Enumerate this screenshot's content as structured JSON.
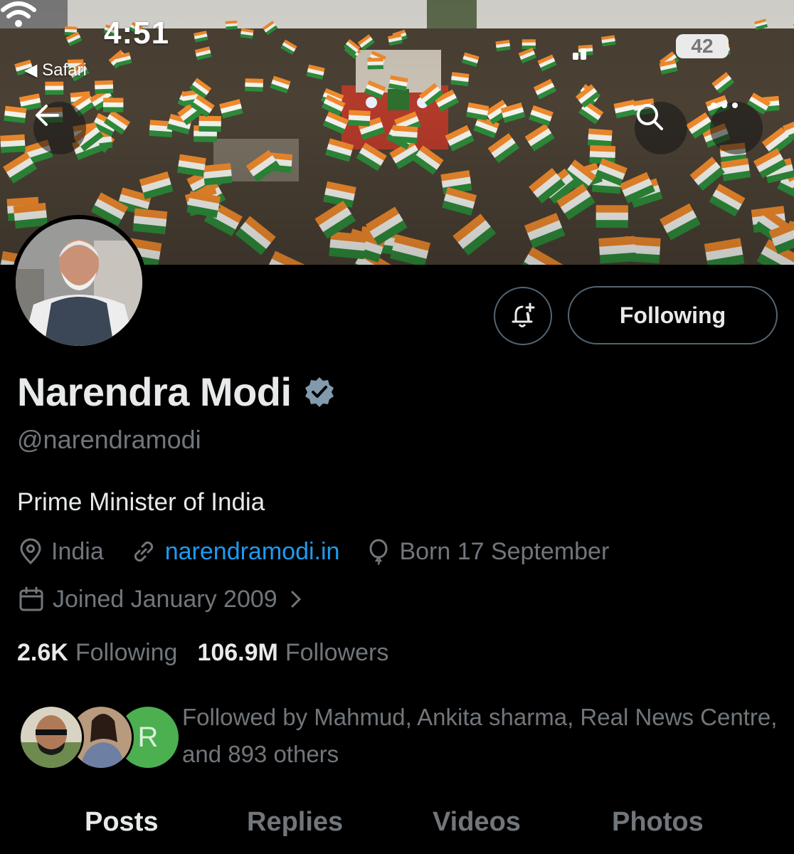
{
  "status_bar": {
    "time": "4:51",
    "back_app": "◀ Safari",
    "battery": "42"
  },
  "banner": {
    "back_icon": "arrow-left-icon",
    "search_icon": "search-icon",
    "more_icon": "more-horizontal-icon"
  },
  "profile": {
    "name": "Narendra Modi",
    "handle": "@narendramodi",
    "bio": "Prime Minister of India",
    "location": "India",
    "website": "narendramodi.in",
    "birthday": "Born 17 September",
    "joined": "Joined January 2009",
    "following_count": "2.6K",
    "following_label": "Following",
    "followers_count": "106.9M",
    "followers_label": "Followers",
    "followed_by_text": "Followed by Mahmud, Ankita sharma, Real News Centre, and 893 others",
    "followed_by_third_initial": "R"
  },
  "actions": {
    "follow_label": "Following"
  },
  "tabs": [
    {
      "label": "Posts",
      "active": true
    },
    {
      "label": "Replies",
      "active": false
    },
    {
      "label": "Videos",
      "active": false
    },
    {
      "label": "Photos",
      "active": false
    }
  ],
  "colors": {
    "accent": "#1d9bf0",
    "verified": "#829aab",
    "secondary_text": "#71767b",
    "follower_avatar_green": "#4caf50"
  }
}
